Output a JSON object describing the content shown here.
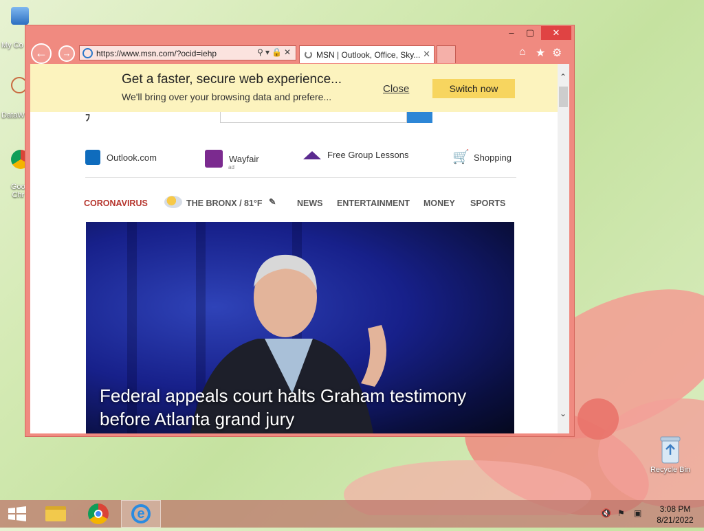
{
  "desktop": {
    "icons": [
      {
        "label": "My Co",
        "icon": "computer-icon"
      },
      {
        "label": "DataW",
        "icon": "datawrangler-icon"
      },
      {
        "label": "Goo\nChr",
        "icon": "chrome-icon"
      },
      {
        "label": "Recycle Bin",
        "icon": "recycle-bin-icon"
      }
    ]
  },
  "browser": {
    "address_url": "https://www.msn.com/?ocid=iehp",
    "tab_title": "MSN | Outlook, Office, Sky...",
    "toolbar_icons": [
      "home-icon",
      "favorites-star-icon",
      "settings-gear-icon"
    ]
  },
  "notification": {
    "heading": "Get a faster, secure web experience...",
    "subtext": "We'll bring over your browsing data and prefere...",
    "close_label": "Close",
    "switch_label": "Switch now"
  },
  "quick_links": [
    {
      "label": "Outlook.com",
      "icon": "outlook-icon"
    },
    {
      "label": "Wayfair",
      "icon": "wayfair-icon",
      "tag": "ad"
    },
    {
      "label": "Free Group Lessons",
      "icon": "graduation-cap-icon"
    },
    {
      "label": "Shopping",
      "icon": "shopping-cart-icon"
    }
  ],
  "nav": {
    "coronavirus": "CORONAVIRUS",
    "weather": "THE BRONX / 81°F",
    "items": [
      "NEWS",
      "ENTERTAINMENT",
      "MONEY",
      "SPORTS"
    ]
  },
  "hero": {
    "headline_line1": "Federal appeals court halts Graham testimony",
    "headline_line2": "before Atlanta grand jury"
  },
  "taskbar": {
    "time": "3:08 PM",
    "date": "8/21/2022",
    "accent": "#e04343"
  }
}
